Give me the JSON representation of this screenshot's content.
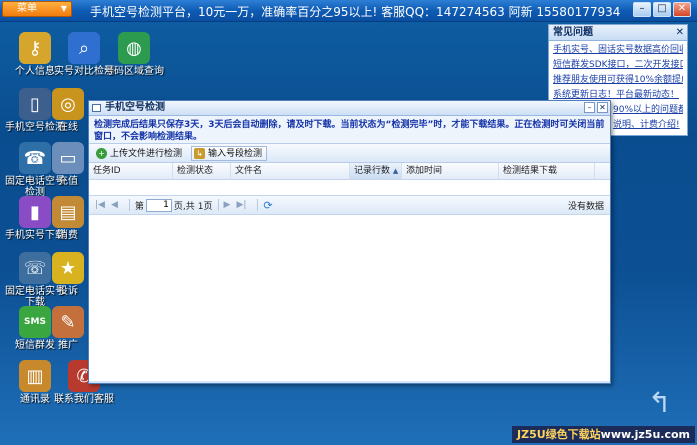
{
  "topbar": {
    "menu_label": "菜单",
    "title": "手机空号检测平台，10元一万，准确率百分之95以上! 客服QQ：147274563 阿新 15580177934"
  },
  "desktop_icons": [
    {
      "label": "个人信息",
      "icon": "key-icon",
      "color": "#d6a62c"
    },
    {
      "label": "实号对比检测",
      "icon": "magnifier-icon",
      "color": "#2f6fd0"
    },
    {
      "label": "号码区域查询",
      "icon": "globe-icon",
      "color": "#2c9a4f"
    },
    {
      "label": "手机空号检测",
      "icon": "phone-icon",
      "color": "#3d5f8e"
    },
    {
      "label": "在线",
      "icon": "coins-icon",
      "color": "#c9941e"
    },
    {
      "label": "固定电话空号检测",
      "icon": "telephone-icon",
      "color": "#2f6fa8"
    },
    {
      "label": "充值",
      "icon": "card-icon",
      "color": "#6b8fba"
    },
    {
      "label": "手机实号下载",
      "icon": "mobile-download-icon",
      "color": "#8a4cc5"
    },
    {
      "label": "消费",
      "icon": "document-icon",
      "color": "#c38a36"
    },
    {
      "label": "固定电话实号下载",
      "icon": "telephone-download-icon",
      "color": "#3e6e9e"
    },
    {
      "label": "投诉",
      "icon": "star-icon",
      "color": "#d9b21f"
    },
    {
      "label": "短信群发",
      "icon": "sms-icon",
      "color": "#3aa640"
    },
    {
      "label": "推广",
      "icon": "tag-icon",
      "color": "#c3703d"
    },
    {
      "label": "通讯录",
      "icon": "book-icon",
      "color": "#c8892c"
    },
    {
      "label": "联系我们客服",
      "icon": "handset-icon",
      "color": "#b83a2e"
    }
  ],
  "issues": {
    "title": "常见问题",
    "items": [
      "手机实号、固话实号数据高价回收",
      "短信群发SDK接口，二次开发接口",
      "推荐朋友使用可获得10%余额提成",
      "系统更新日志！平台最新动态！",
      "90%以上的问题都有",
      "说明、计费介绍!"
    ]
  },
  "dialog": {
    "title": "手机空号检测",
    "notice": "检测完成后结果只保存3天，3天后会自动删除，请及时下载。当前状态为“检测完毕”时，才能下载结果。正在检测时可关闭当前窗口，不会影响检测结果。",
    "buttons": {
      "upload": "上传文件进行检测",
      "import": "输入号段检测"
    },
    "columns": [
      "任务ID",
      "检测状态",
      "文件名",
      "记录行数",
      "添加时间",
      "检测结果下载"
    ],
    "pager": {
      "page_prefix": "第",
      "page_value": "1",
      "page_suffix": "页,共",
      "total_pages": "1页",
      "status": "没有数据"
    }
  },
  "watermark": {
    "prefix": "JZ5U绿色下载站",
    "url": "www.jz5u.com"
  }
}
